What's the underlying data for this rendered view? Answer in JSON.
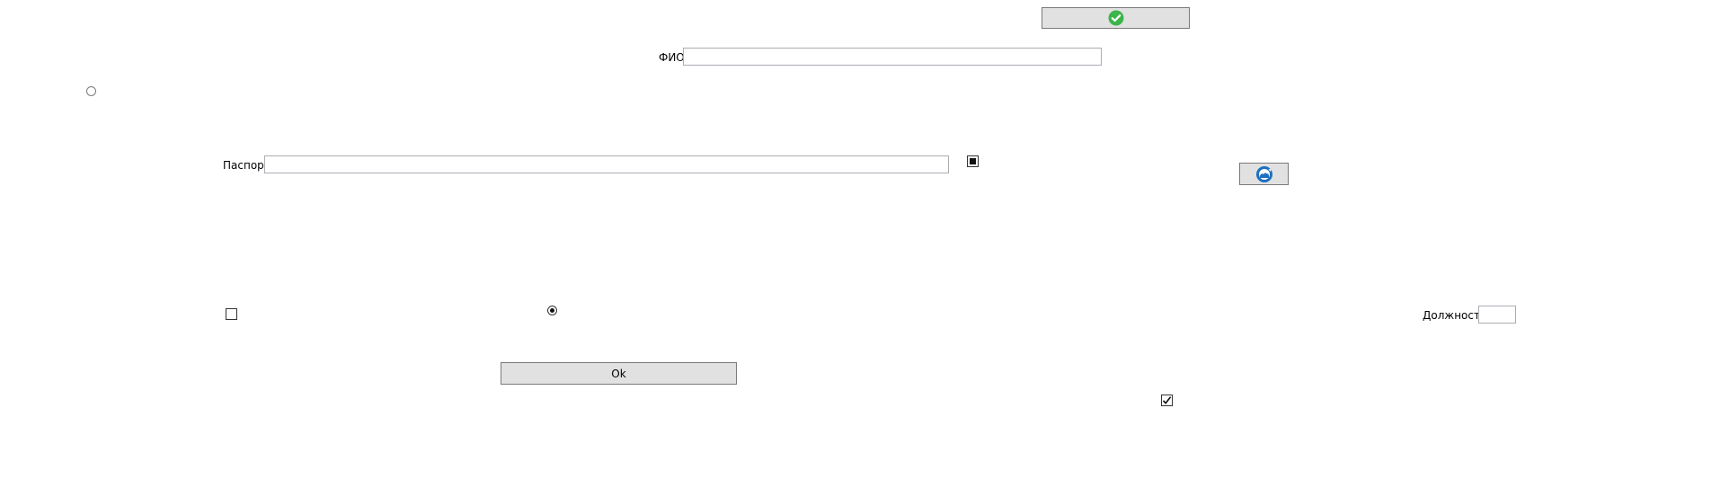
{
  "form": {
    "top_button": {
      "icon": "green-check-circle-icon",
      "icon_color": "#3cb54a"
    },
    "fio": {
      "label": "ФИО",
      "value": ""
    },
    "radio_left": {
      "checked": false
    },
    "passport": {
      "label": "Паспорт",
      "value": ""
    },
    "indeterminate_checkbox": {
      "state": "indeterminate"
    },
    "web_button": {
      "icon": "globe-refresh-icon",
      "icon_color": "#1e6fc0"
    },
    "checkbox_unchecked": {
      "checked": false
    },
    "radio_checked": {
      "checked": true
    },
    "position": {
      "label": "Должность",
      "value": ""
    },
    "ok_button": {
      "label": "Ok"
    },
    "checkbox_checked": {
      "checked": true
    }
  }
}
